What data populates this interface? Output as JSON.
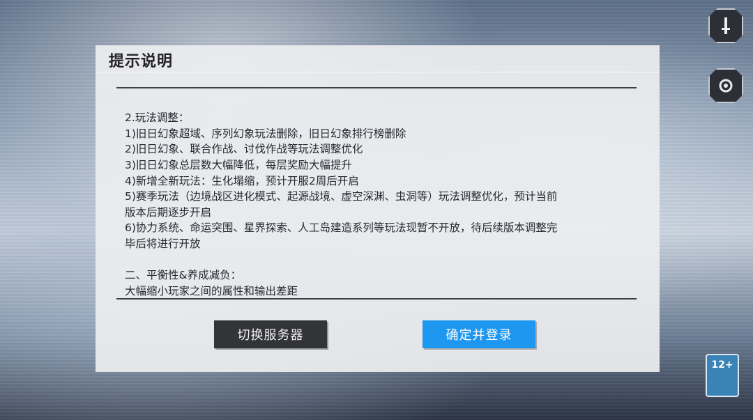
{
  "dialog": {
    "title": "提示说明",
    "lines": [
      "2.玩法调整：",
      "1)旧日幻象超域、序列幻象玩法删除，旧日幻象排行榜删除",
      "2)旧日幻象、联合作战、讨伐作战等玩法调整优化",
      "3)旧日幻象总层数大幅降低，每层奖励大幅提升",
      "4)新增全新玩法：生化塌缩，预计开服2周后开启",
      "5)赛季玩法（边境战区进化模式、起源战境、虚空深渊、虫洞等）玩法调整优化，预计当前",
      "版本后期逐步开启",
      "6)协力系统、命运突围、星界探索、人工岛建造系列等玩法现暂不开放，待后续版本调整完",
      "毕后将进行开放",
      "二、平衡性&养成减负：",
      "大幅缩小玩家之间的属性和输出差距"
    ]
  },
  "buttons": {
    "switch_server": "切换服务器",
    "confirm_login": "确定并登录"
  },
  "side": {
    "age_rating": "12+"
  },
  "colors": {
    "confirm_button": "#1e97f0",
    "switch_button": "#333437",
    "dialog_bg": "#ecedef"
  }
}
